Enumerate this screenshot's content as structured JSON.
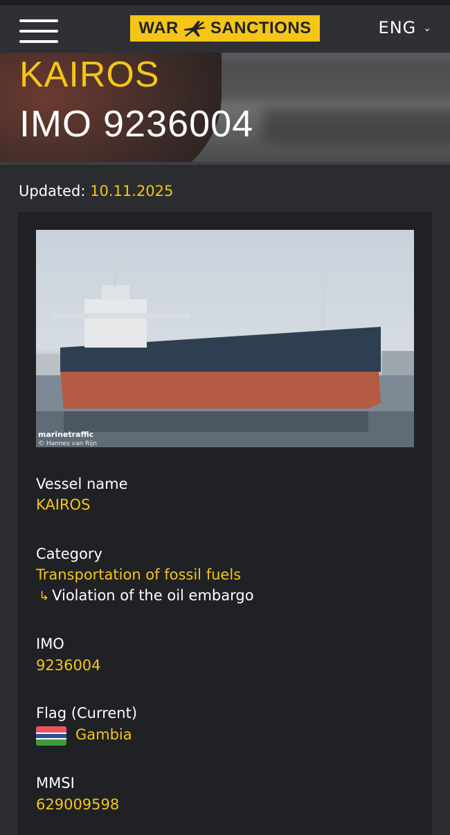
{
  "header": {
    "logo_left": "WAR",
    "logo_right": "SANCTIONS",
    "language": "ENG"
  },
  "hero": {
    "vessel_name": "KAIROS",
    "imo_title": "IMO 9236004"
  },
  "updated": {
    "label": "Updated:",
    "date": "10.11.2025"
  },
  "photo": {
    "credit_brand": "marinetraffic",
    "credit_author": "© Hannes van Rijn"
  },
  "fields": {
    "vessel_name": {
      "label": "Vessel name",
      "value": "KAIROS"
    },
    "category": {
      "label": "Category",
      "value": "Transportation of fossil fuels",
      "sub_value": "Violation of the oil embargo"
    },
    "imo": {
      "label": "IMO",
      "value": "9236004"
    },
    "flag": {
      "label": "Flag (Current)",
      "value": "Gambia"
    },
    "mmsi": {
      "label": "MMSI",
      "value": "629009598"
    }
  },
  "colors": {
    "accent": "#f5c518",
    "background": "#2b2c2f",
    "card": "#202124"
  },
  "icons": [
    "menu-icon",
    "plane-icon",
    "chevron-down-icon",
    "subcategory-arrow-icon",
    "gambia-flag-icon"
  ]
}
